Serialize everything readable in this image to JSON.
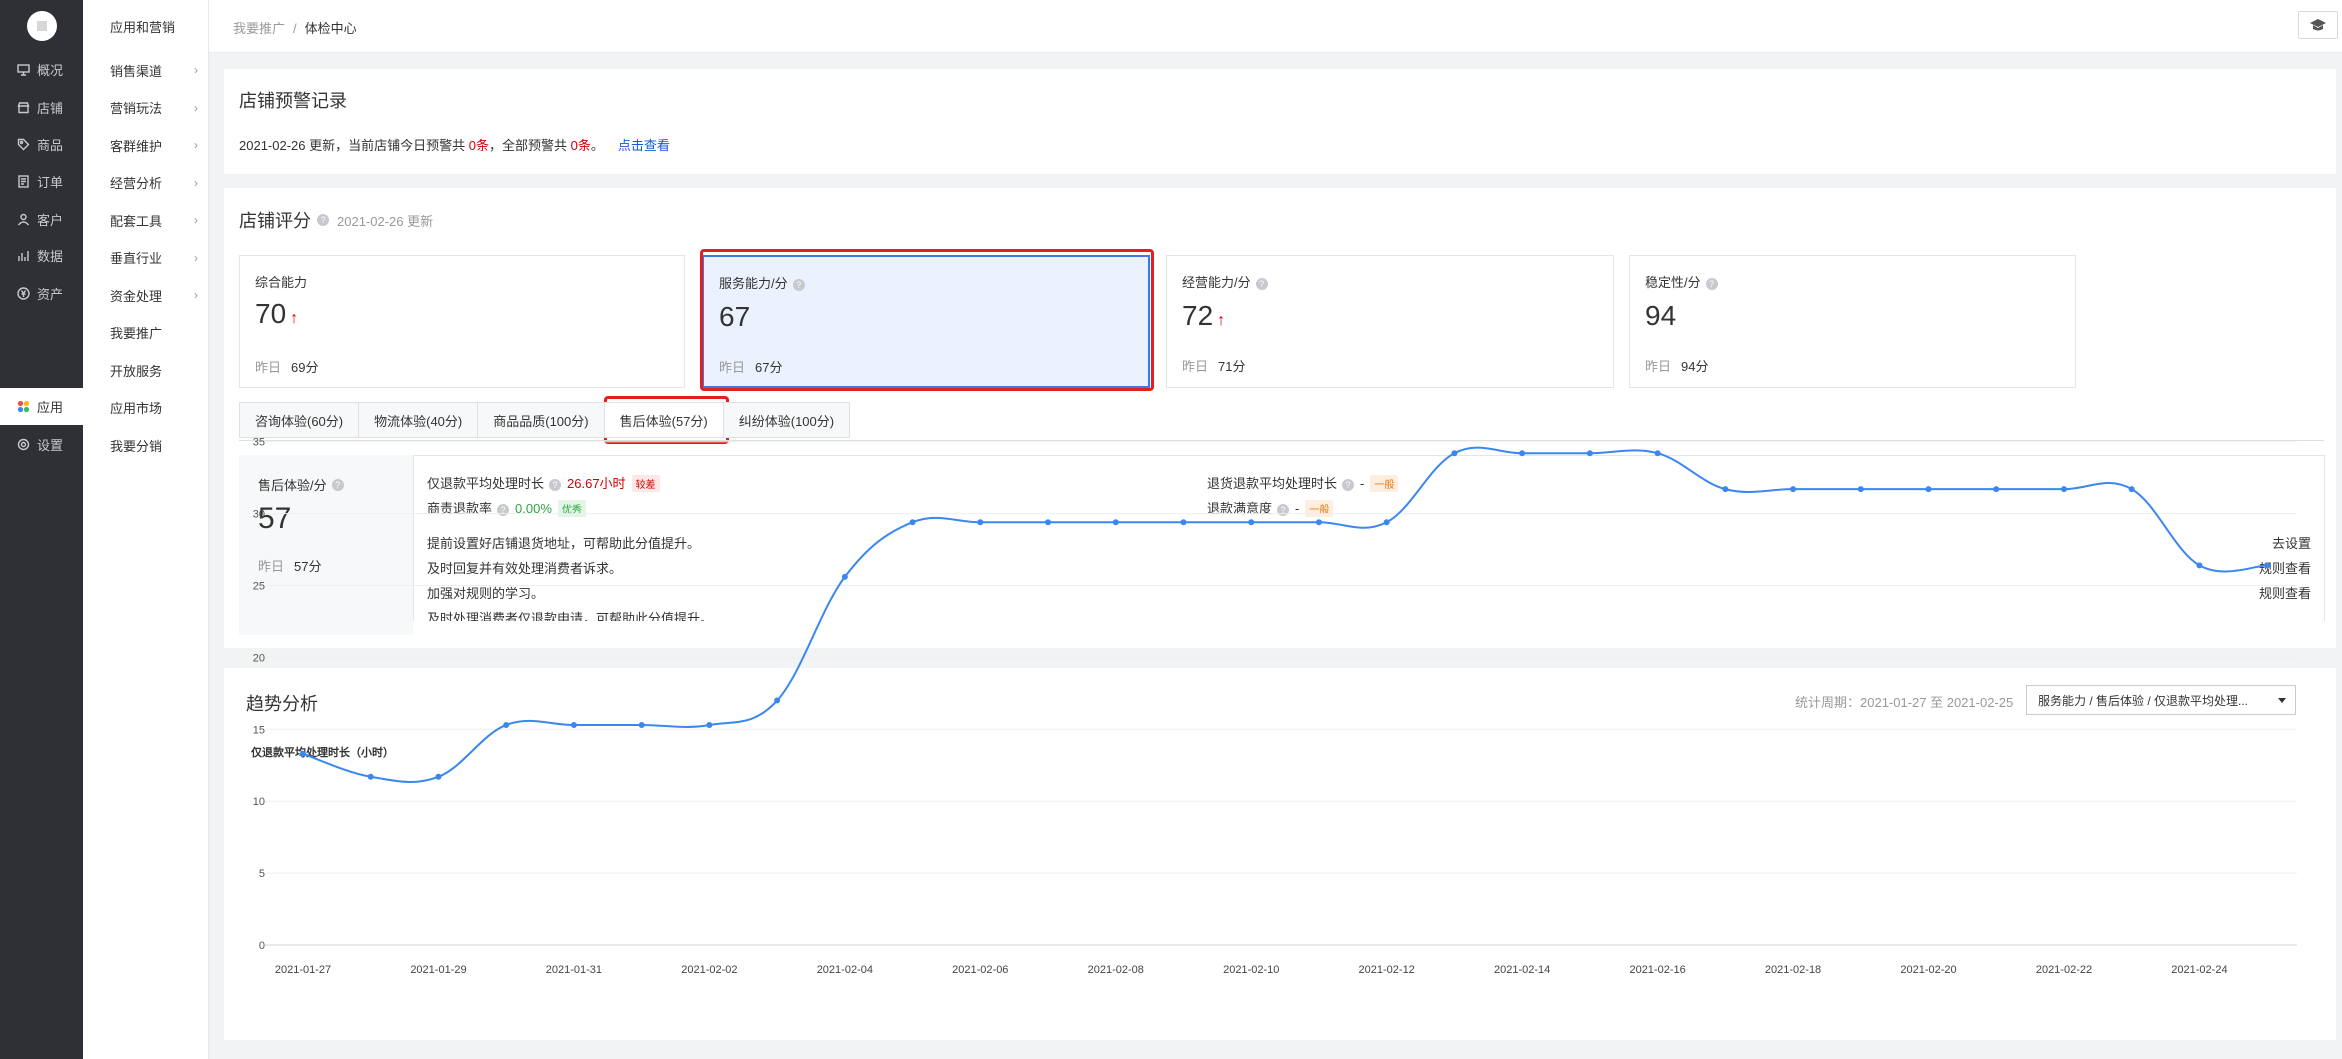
{
  "sidebar": {
    "items": [
      {
        "label": "概况",
        "icon": "monitor-icon"
      },
      {
        "label": "店铺",
        "icon": "store-icon"
      },
      {
        "label": "商品",
        "icon": "tag-icon"
      },
      {
        "label": "订单",
        "icon": "document-icon"
      },
      {
        "label": "客户",
        "icon": "user-icon"
      },
      {
        "label": "数据",
        "icon": "bar-chart-icon"
      },
      {
        "label": "资产",
        "icon": "currency-icon"
      },
      {
        "label": "应用",
        "icon": "apps-icon"
      },
      {
        "label": "设置",
        "icon": "gear-icon"
      }
    ],
    "active": "应用"
  },
  "subnav": {
    "title": "应用和营销",
    "items": [
      {
        "label": "销售渠道",
        "chevron": true
      },
      {
        "label": "营销玩法",
        "chevron": true
      },
      {
        "label": "客群维护",
        "chevron": true
      },
      {
        "label": "经营分析",
        "chevron": true
      },
      {
        "label": "配套工具",
        "chevron": true
      },
      {
        "label": "垂直行业",
        "chevron": true
      },
      {
        "label": "资金处理",
        "chevron": true
      },
      {
        "label": "我要推广",
        "chevron": false
      },
      {
        "label": "开放服务",
        "chevron": false
      },
      {
        "label": "应用市场",
        "chevron": false
      },
      {
        "label": "我要分销",
        "chevron": false
      }
    ]
  },
  "breadcrumb": {
    "parent": "我要推广",
    "separator": "/",
    "current": "体检中心"
  },
  "warning": {
    "title": "店铺预警记录",
    "text_1": "2021-02-26 更新，当前店铺今日预警共 ",
    "count_today": "0条",
    "text_2": "，全部预警共 ",
    "count_all": "0条",
    "text_3": "。",
    "link": "点击查看"
  },
  "score": {
    "title": "店铺评分",
    "updated": "2021-02-26 更新",
    "yesterday_label": "昨日",
    "cards": [
      {
        "label": "综合能力",
        "value": "70",
        "trend_up": true,
        "yesterday": "69分",
        "help": false
      },
      {
        "label": "服务能力/分",
        "value": "67",
        "trend_up": false,
        "yesterday": "67分",
        "help": true
      },
      {
        "label": "经营能力/分",
        "value": "72",
        "trend_up": true,
        "yesterday": "71分",
        "help": true
      },
      {
        "label": "稳定性/分",
        "value": "94",
        "trend_up": false,
        "yesterday": "94分",
        "help": true
      }
    ]
  },
  "tabs": [
    {
      "label": "咨询体验(60分)"
    },
    {
      "label": "物流体验(40分)"
    },
    {
      "label": "商品品质(100分)"
    },
    {
      "label": "售后体验(57分)"
    },
    {
      "label": "纠纷体验(100分)"
    }
  ],
  "active_tab": 3,
  "aftersale": {
    "label": "售后体验/分",
    "value": "57",
    "yesterday_label": "昨日",
    "yesterday": "57分",
    "metrics": [
      {
        "name": "仅退款平均处理时长",
        "value": "26.67小时",
        "tag": "较差"
      },
      {
        "name": "退货退款平均处理时长",
        "value": "-",
        "tag": "一般"
      },
      {
        "name": "商责退款率",
        "value": "0.00%",
        "tag": "优秀"
      },
      {
        "name": "退款满意度",
        "value": "-",
        "tag": "一般"
      }
    ],
    "tips": [
      {
        "text": "提前设置好店铺退货地址，可帮助此分值提升。",
        "link": "去设置"
      },
      {
        "text": "及时回复并有效处理消费者诉求。",
        "link": "规则查看"
      },
      {
        "text": "加强对规则的学习。",
        "link": "规则查看"
      },
      {
        "text": "及时处理消费者仅退款申请，可帮助此分值提升。",
        "link": ""
      }
    ]
  },
  "trend": {
    "title": "趋势分析",
    "period_label": "统计周期：2021-01-27 至 2021-02-25",
    "select_value": "服务能力 / 售后体验 / 仅退款平均处理..."
  },
  "chart_data": {
    "type": "line",
    "title": "仅退款平均处理时长（小时）",
    "x": [
      "2021-01-27",
      "2021-01-28",
      "2021-01-29",
      "2021-01-30",
      "2021-01-31",
      "2021-02-01",
      "2021-02-02",
      "2021-02-03",
      "2021-02-04",
      "2021-02-05",
      "2021-02-06",
      "2021-02-07",
      "2021-02-08",
      "2021-02-09",
      "2021-02-10",
      "2021-02-11",
      "2021-02-12",
      "2021-02-13",
      "2021-02-14",
      "2021-02-15",
      "2021-02-16",
      "2021-02-17",
      "2021-02-18",
      "2021-02-19",
      "2021-02-20",
      "2021-02-21",
      "2021-02-22",
      "2021-02-23",
      "2021-02-24",
      "2021-02-25"
    ],
    "x_tick_labels": [
      "2021-01-27",
      "2021-01-29",
      "2021-01-31",
      "2021-02-02",
      "2021-02-04",
      "2021-02-06",
      "2021-02-08",
      "2021-02-10",
      "2021-02-12",
      "2021-02-14",
      "2021-02-16",
      "2021-02-18",
      "2021-02-20",
      "2021-02-22",
      "2021-02-24"
    ],
    "series": [
      {
        "values": [
          13.3,
          11.7,
          11.7,
          15.3,
          15.3,
          15.3,
          15.3,
          17.0,
          25.6,
          29.4,
          29.4,
          29.4,
          29.4,
          29.4,
          29.4,
          29.4,
          29.4,
          34.2,
          34.2,
          34.2,
          34.2,
          31.7,
          31.7,
          31.7,
          31.7,
          31.7,
          31.7,
          31.7,
          26.4,
          26.4
        ]
      }
    ],
    "ylim": [
      0,
      35
    ],
    "y_ticks": [
      0,
      5,
      10,
      15,
      20,
      25,
      30,
      35
    ],
    "grid": true,
    "color": "#3a87f0"
  }
}
